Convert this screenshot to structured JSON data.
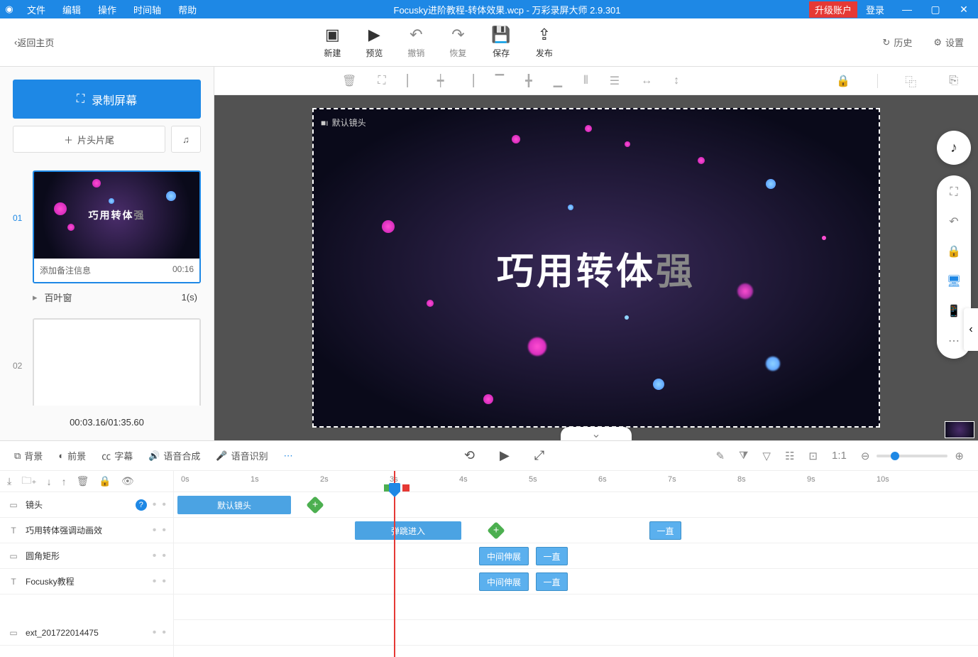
{
  "titlebar": {
    "menus": [
      "文件",
      "编辑",
      "操作",
      "时间轴",
      "帮助"
    ],
    "title": "Focusky进阶教程-转体效果.wcp - 万彩录屏大师 2.9.301",
    "upgrade": "升级账户",
    "login": "登录"
  },
  "toolbar": {
    "back": "返回主页",
    "buttons": [
      {
        "icon": "＋",
        "label": "新建"
      },
      {
        "icon": "▶",
        "label": "预览"
      },
      {
        "icon": "↶",
        "label": "撤销"
      },
      {
        "icon": "↷",
        "label": "恢复"
      },
      {
        "icon": "💾",
        "label": "保存"
      },
      {
        "icon": "⬆",
        "label": "发布"
      }
    ],
    "history": "历史",
    "settings": "设置"
  },
  "sidebar": {
    "record": "录制屏幕",
    "titles": "片头片尾",
    "slides": [
      {
        "num": "01",
        "text": "巧用转体",
        "dim": "强",
        "caption": "添加备注信息",
        "time": "00:16"
      },
      {
        "num": "02",
        "text": "",
        "dim": "",
        "caption": "",
        "time": ""
      }
    ],
    "effect": {
      "name": "百叶窗",
      "time": "1(s)"
    },
    "timecode": "00:03.16/01:35.60"
  },
  "canvas": {
    "frame_label": "默认镜头",
    "main_text": "巧用转体",
    "main_dim": "强"
  },
  "timeline": {
    "tabs": [
      "背景",
      "前景",
      "字幕",
      "语音合成",
      "语音识别"
    ],
    "ticks": [
      "0s",
      "1s",
      "2s",
      "3s",
      "4s",
      "5s",
      "6s",
      "7s",
      "8s",
      "9s",
      "10s"
    ],
    "tracks": [
      {
        "icon": "▭",
        "name": "镜头",
        "help": true
      },
      {
        "icon": "T",
        "name": "巧用转体强调动画效"
      },
      {
        "icon": "▭",
        "name": "圆角矩形"
      },
      {
        "icon": "T",
        "name": "Focusky教程"
      },
      {
        "icon": "▭",
        "name": "ext_201722014475"
      }
    ],
    "clips": {
      "default_camera": "默认镜头",
      "bounce_in": "弹跳进入",
      "always": "一直",
      "mid_expand": "中间伸展"
    }
  }
}
